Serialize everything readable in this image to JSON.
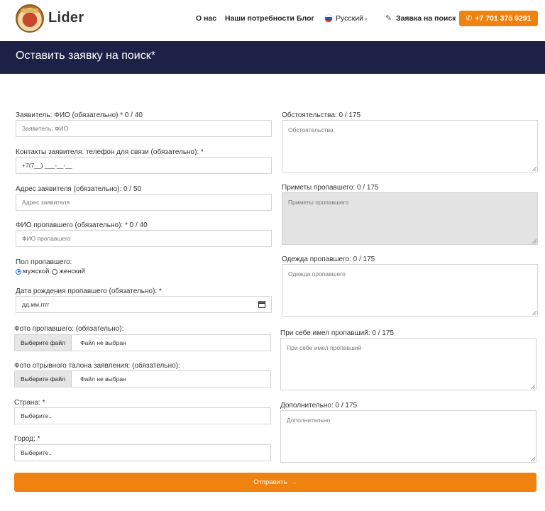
{
  "header": {
    "brand": "Lider",
    "nav": [
      "О нас",
      "Наши потребности",
      "Блог"
    ],
    "language": "Русский",
    "search_request": "Заявка на поиск",
    "phone": "+7 701 375 9291",
    "accent_color": "#f0820f"
  },
  "banner": {
    "title": "Оставить заявку на поиск*",
    "background": "#1c2145"
  },
  "form": {
    "left": {
      "applicant_name_label": "Заявитель: ФИО (обязательно) * 0 / 40",
      "applicant_name_placeholder": "Заявитель: ФИО",
      "contacts_label": "Контакты заявителя: телефон для связи (обязательно): *",
      "contacts_value": "+7(7__) ___-__-__",
      "address_label": "Адрес заявителя (обязательно): 0 / 50",
      "address_placeholder": "Адрес заявителя",
      "missing_name_label": "ФИО пропавшего (обязательно): * 0 / 40",
      "missing_name_placeholder": "ФИО пропавшего",
      "gender_label": "Пол пропавшего:",
      "gender_male": "мужской",
      "gender_female": "женский",
      "gender_selected": "мужской",
      "birthdate_label": "Дата рождения пропавшего (обязательно): *",
      "birthdate_value": "дд.мм.гггг",
      "photo_label": "Фото пропавшего: (обязательно):",
      "photo_button": "Выберите файл",
      "photo_status": "Файл не выбран",
      "ticket_label": "Фото отрывного талона заявления: (обязательно):",
      "ticket_button": "Выберите файл",
      "ticket_status": "Файл не выбран",
      "country_label": "Страна: *",
      "country_value": "Выберите..",
      "city_label": "Город: *",
      "city_value": "Выберите.."
    },
    "right": {
      "circumstances_label": "Обстоятельства: 0 / 175",
      "circumstances_placeholder": "Обстоятельства",
      "signs_label": "Приметы пропавшего: 0 / 175",
      "signs_placeholder": "Приметы пропавшего",
      "clothes_label": "Одежда пропавшего: 0 / 175",
      "clothes_placeholder": "Одежда пропавшего",
      "belongings_label": "При себе имел пропавший: 0 / 175",
      "belongings_placeholder": "При себе имел пропавший",
      "extra_label": "Дополнительно: 0 / 175",
      "extra_placeholder": "Дополнительно"
    },
    "submit_label": "Отправить"
  }
}
